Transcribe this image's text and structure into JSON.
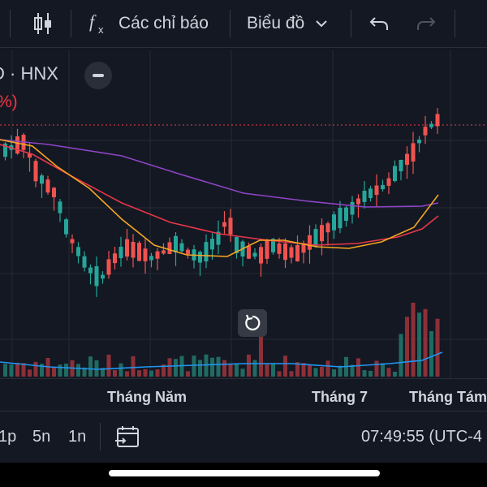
{
  "toolbar": {
    "indicators_label": "Các chỉ báo",
    "chart_type_label": "Biểu đồ"
  },
  "legend": {
    "symbol": "D · HNX",
    "change": "%)"
  },
  "time_axis": {
    "labels": [
      "Tháng Năm",
      "Tháng 7",
      "Tháng Tám"
    ]
  },
  "bottom_bar": {
    "ranges": [
      "1p",
      "5n",
      "1n"
    ],
    "clock": "07:49:55 (UTC-4"
  },
  "colors": {
    "up": "#26a69a",
    "down": "#ef5350",
    "ma_fast": "#f5a623",
    "ma_mid": "#e8374a",
    "ma_slow": "#8e44c6",
    "volume_ma": "#2196f3",
    "last_price_line": "#f23645"
  },
  "icons": [
    "candles-icon",
    "fx-icon",
    "chevron-down-icon",
    "undo-icon",
    "redo-icon",
    "minus-icon",
    "reset-icon",
    "calendar-range-icon"
  ]
}
